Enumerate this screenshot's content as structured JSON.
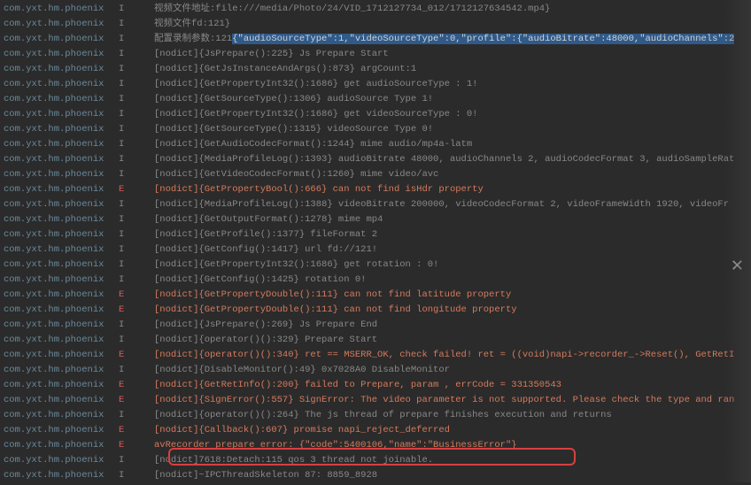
{
  "tag": "com.yxt.hm.phoenix",
  "close_icon": "✕",
  "lines": [
    {
      "level": "I",
      "msg": "视频文件地址:file:///media/Photo/24/VID_1712127734_012/1712127634542.mp4}",
      "err": false
    },
    {
      "level": "I",
      "msg": "视频文件fd:121}",
      "err": false
    },
    {
      "level": "I",
      "prefix": "配置录制参数:121",
      "highlight": "{\"audioSourceType\":1,\"videoSourceType\":0,\"profile\":{\"audioBitrate\":48000,\"audioChannels\":2",
      "err": false
    },
    {
      "level": "I",
      "msg": "[nodict]{JsPrepare():225} Js Prepare Start",
      "err": false
    },
    {
      "level": "I",
      "msg": "[nodict]{GetJsInstanceAndArgs():873} argCount:1",
      "err": false
    },
    {
      "level": "I",
      "msg": "[nodict]{GetPropertyInt32():1686} get audioSourceType : 1!",
      "err": false
    },
    {
      "level": "I",
      "msg": "[nodict]{GetSourceType():1306} audioSource Type 1!",
      "err": false
    },
    {
      "level": "I",
      "msg": "[nodict]{GetPropertyInt32():1686} get videoSourceType : 0!",
      "err": false
    },
    {
      "level": "I",
      "msg": "[nodict]{GetSourceType():1315} videoSource Type 0!",
      "err": false
    },
    {
      "level": "I",
      "msg": "[nodict]{GetAudioCodecFormat():1244} mime audio/mp4a-latm",
      "err": false
    },
    {
      "level": "I",
      "msg": "[nodict]{MediaProfileLog():1393} audioBitrate 48000, audioChannels 2, audioCodecFormat 3, audioSampleRat",
      "err": false
    },
    {
      "level": "I",
      "msg": "[nodict]{GetVideoCodecFormat():1260} mime video/avc",
      "err": false
    },
    {
      "level": "E",
      "msg": "[nodict]{GetPropertyBool():666} can not find isHdr property",
      "err": true
    },
    {
      "level": "I",
      "msg": "[nodict]{MediaProfileLog():1388} videoBitrate 200000, videoCodecFormat 2, videoFrameWidth 1920, videoFr",
      "err": false
    },
    {
      "level": "I",
      "msg": "[nodict]{GetOutputFormat():1278} mime mp4",
      "err": false
    },
    {
      "level": "I",
      "msg": "[nodict]{GetProfile():1377} fileFormat 2",
      "err": false
    },
    {
      "level": "I",
      "msg": "[nodict]{GetConfig():1417} url fd://121!",
      "err": false
    },
    {
      "level": "I",
      "msg": "[nodict]{GetPropertyInt32():1686} get rotation : 0!",
      "err": false
    },
    {
      "level": "I",
      "msg": "[nodict]{GetConfig():1425} rotation 0!",
      "err": false
    },
    {
      "level": "E",
      "msg": "[nodict]{GetPropertyDouble():111} can not find latitude property",
      "err": true
    },
    {
      "level": "E",
      "msg": "[nodict]{GetPropertyDouble():111} can not find longitude property",
      "err": true
    },
    {
      "level": "I",
      "msg": "[nodict]{JsPrepare():269} Js Prepare End",
      "err": false
    },
    {
      "level": "I",
      "msg": "[nodict]{operator()():329} Prepare Start",
      "err": false
    },
    {
      "level": "E",
      "msg": "[nodict]{operator()():340} ret == MSERR_OK, check failed! ret = ((void)napi->recorder_->Reset(), GetRetI",
      "err": true
    },
    {
      "level": "I",
      "msg": "[nodict]{DisableMonitor():49} 0x7028A0 DisableMonitor",
      "err": false
    },
    {
      "level": "E",
      "msg": "[nodict]{GetRetInfo():200} failed to Prepare, param , errCode = 331350543",
      "err": true
    },
    {
      "level": "E",
      "msg": "[nodict]{SignError():557} SignError: The video parameter is not supported. Please check the type and ran",
      "err": true
    },
    {
      "level": "I",
      "msg": "[nodict]{operator()():264} The js thread of prepare finishes execution and returns",
      "err": false
    },
    {
      "level": "E",
      "msg": "[nodict]{Callback():607} promise napi_reject_deferred",
      "err": true
    },
    {
      "level": "E",
      "msg": "avRecorder prepare error: {\"code\":5400106,\"name\":\"BusinessError\"}",
      "err": true
    },
    {
      "level": "I",
      "msg": "[nodict]7618:Detach:115 qos 3 thread not joinable.",
      "err": false
    },
    {
      "level": "I",
      "msg": "[nodict]~IPCThreadSkeleton 87: 8859_8928",
      "err": false
    }
  ]
}
